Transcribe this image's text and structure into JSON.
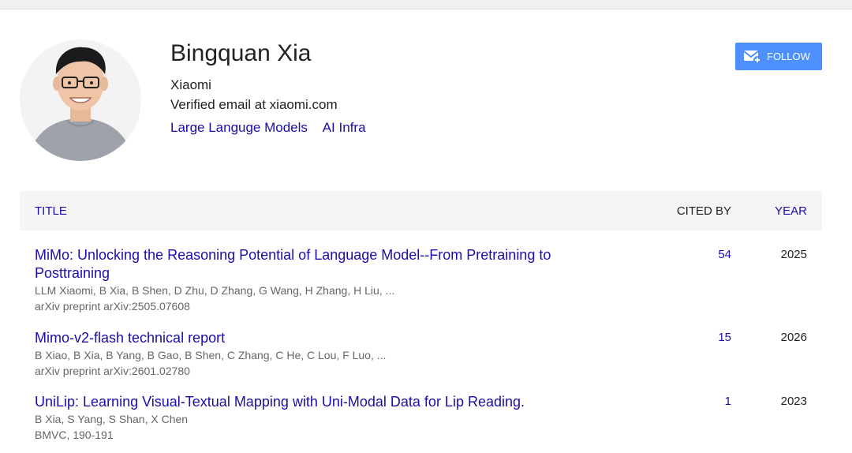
{
  "profile": {
    "name": "Bingquan Xia",
    "affiliation": "Xiaomi",
    "email": "Verified email at xiaomi.com",
    "interests": [
      "Large Languge Models",
      "AI Infra"
    ]
  },
  "follow": {
    "label": "FOLLOW",
    "icon": "mail-plus-icon"
  },
  "table": {
    "col_title": "TITLE",
    "col_cited": "CITED BY",
    "col_year": "YEAR",
    "rows": [
      {
        "title": "MiMo: Unlocking the Reasoning Potential of Language Model--From Pretraining to Posttraining",
        "authors": "LLM Xiaomi, B Xia, B Shen, D Zhu, D Zhang, G Wang, H Zhang, H Liu, ...",
        "venue": "arXiv preprint arXiv:2505.07608",
        "cited": "54",
        "year": "2025"
      },
      {
        "title": "Mimo-v2-flash technical report",
        "authors": "B Xiao, B Xia, B Yang, B Gao, B Shen, C Zhang, C He, C Lou, F Luo, ...",
        "venue": "arXiv preprint arXiv:2601.02780",
        "cited": "15",
        "year": "2026"
      },
      {
        "title": "UniLip: Learning Visual-Textual Mapping with Uni-Modal Data for Lip Reading.",
        "authors": "B Xia, S Yang, S Shan, X Chen",
        "venue": "BMVC, 190-191",
        "cited": "1",
        "year": "2023"
      }
    ]
  },
  "colors": {
    "link": "#1a0dab",
    "follow_bg": "#4d90fe",
    "header_bg": "#f5f5f5"
  }
}
